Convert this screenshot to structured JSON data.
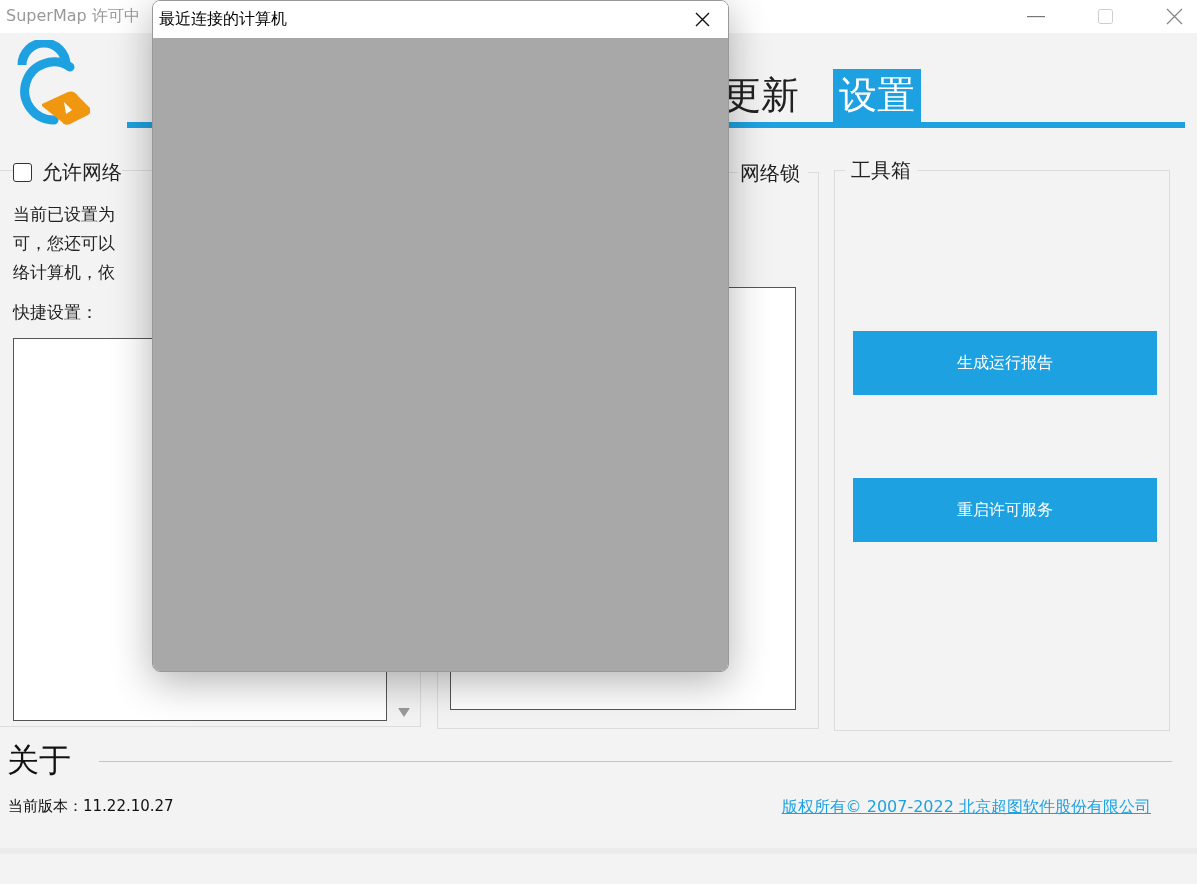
{
  "window": {
    "title": "SuperMap 许可中"
  },
  "tabs": [
    {
      "label": "更新",
      "selected": false
    },
    {
      "label": "设置",
      "selected": true
    }
  ],
  "network_group": {
    "checkbox": {
      "label": "允许网络",
      "checked": false
    },
    "description_lines": [
      "当前已设置为",
      "可，您还可以",
      "络计算机，依"
    ],
    "quick_settings_label": "快捷设置："
  },
  "network_lock": {
    "title": "网络锁"
  },
  "toolbox": {
    "title": "工具箱",
    "buttons": [
      "生成运行报告",
      "重启许可服务"
    ]
  },
  "about": {
    "title": "关于",
    "version": "当前版本：11.22.10.27",
    "copyright": "版权所有© 2007-2022 北京超图软件股份有限公司"
  },
  "dialog": {
    "title": "最近连接的计算机"
  }
}
